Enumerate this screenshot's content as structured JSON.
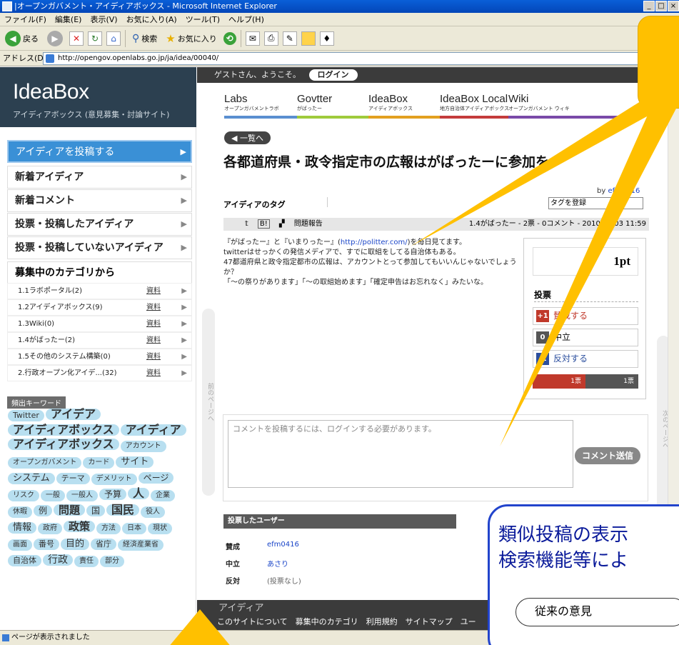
{
  "window": {
    "title": "|オープンガバメント・アイディアボックス - Microsoft Internet Explorer",
    "min": "_",
    "max": "□",
    "close": "×"
  },
  "menu": [
    "ファイル(F)",
    "編集(E)",
    "表示(V)",
    "お気に入り(A)",
    "ツール(T)",
    "ヘルプ(H)"
  ],
  "toolbar": {
    "back": "戻る",
    "search": "検索",
    "favorites": "お気に入り"
  },
  "address": {
    "label": "アドレス(D)",
    "url": "http://opengov.openlabs.go.jp/ja/idea/00040/",
    "go": "▶"
  },
  "sidebar": {
    "logo": "IdeaBox",
    "logo_sub": "アイディアボックス (意見募集・討論サイト)",
    "nav": [
      {
        "label": "アイディアを投稿する"
      },
      {
        "label": "新着アイディア"
      },
      {
        "label": "新着コメント"
      },
      {
        "label": "投票・投稿したアイディア"
      },
      {
        "label": "投票・投稿していないアイディア"
      }
    ],
    "category_header": "募集中のカテゴリから",
    "categories": [
      {
        "label": "1.1ラボポータル(2)",
        "doc": "資料"
      },
      {
        "label": "1.2アイディアボックス(9)",
        "doc": "資料"
      },
      {
        "label": "1.3Wiki(0)",
        "doc": "資料"
      },
      {
        "label": "1.4がばったー(2)",
        "doc": "資料"
      },
      {
        "label": "1.5その他のシステム構築(0)",
        "doc": "資料"
      },
      {
        "label": "2.行政オープン化アイデ...(32)",
        "doc": "資料"
      }
    ],
    "keyword_header": "頻出キーワード",
    "keywords": [
      {
        "t": "Twitter",
        "s": 11
      },
      {
        "t": "アイデア",
        "s": 16
      },
      {
        "t": "アイディアボックス",
        "s": 16
      },
      {
        "t": "アイディア",
        "s": 16
      },
      {
        "t": "アイディアボックス",
        "s": 16
      },
      {
        "t": "アカウント",
        "s": 10
      },
      {
        "t": "オープンガバメント",
        "s": 10
      },
      {
        "t": "カード",
        "s": 10
      },
      {
        "t": "サイト",
        "s": 13
      },
      {
        "t": "システム",
        "s": 13
      },
      {
        "t": "テーマ",
        "s": 11
      },
      {
        "t": "デメリット",
        "s": 10
      },
      {
        "t": "ページ",
        "s": 12
      },
      {
        "t": "リスク",
        "s": 10
      },
      {
        "t": "一般",
        "s": 10
      },
      {
        "t": "一般人",
        "s": 10
      },
      {
        "t": "予算",
        "s": 12
      },
      {
        "t": "人",
        "s": 16
      },
      {
        "t": "企業",
        "s": 10
      },
      {
        "t": "休暇",
        "s": 10
      },
      {
        "t": "例",
        "s": 12
      },
      {
        "t": "問題",
        "s": 15
      },
      {
        "t": "国",
        "s": 12
      },
      {
        "t": "国民",
        "s": 16
      },
      {
        "t": "役人",
        "s": 10
      },
      {
        "t": "情報",
        "s": 13
      },
      {
        "t": "政府",
        "s": 10
      },
      {
        "t": "政策",
        "s": 15
      },
      {
        "t": "方法",
        "s": 10
      },
      {
        "t": "日本",
        "s": 10
      },
      {
        "t": "現状",
        "s": 10
      },
      {
        "t": "画面",
        "s": 10
      },
      {
        "t": "番号",
        "s": 11
      },
      {
        "t": "目的",
        "s": 13
      },
      {
        "t": "省庁",
        "s": 11
      },
      {
        "t": "経済産業省",
        "s": 10
      },
      {
        "t": "自治体",
        "s": 11
      },
      {
        "t": "行政",
        "s": 14
      },
      {
        "t": "責任",
        "s": 10
      },
      {
        "t": "部分",
        "s": 10
      }
    ]
  },
  "header": {
    "greeting": "ゲストさん、ようこそ。",
    "login": "ログイン"
  },
  "sites": [
    {
      "name": "Labs",
      "sub": "オープンガバメントラボ",
      "color": "#5a8fd0"
    },
    {
      "name": "Govtter",
      "sub": "がばったー",
      "color": "#9fcb3c"
    },
    {
      "name": "IdeaBox",
      "sub": "アイディアボックス",
      "color": "#e2a020"
    },
    {
      "name": "IdeaBox Local",
      "sub": "地方自治体アイディアボックス",
      "color": "#c43c3c"
    },
    {
      "name": "Wiki",
      "sub": "オープンガバメント ウィキ",
      "color": "#7a4aa8"
    }
  ],
  "idea": {
    "back": "◀ 一覧へ",
    "title": "各都道府県・政令指定市の広報はがばったーに参加を",
    "tags_label": "アイディアのタグ",
    "by_prefix": "by ",
    "author": "efm0416",
    "tag_select": "タグを登録",
    "report": "問題報告",
    "meta": "1.4がばったー - 2票 - 0コメント - 2010/09/03 11:59",
    "body": [
      {
        "pre": "『がばったー』と『いまりったー』(",
        "link": "http://politter.com/",
        "post": ")を毎日見てます。"
      },
      {
        "pre": "twitterはせっかくの発信メディアで、すでに取組をしてる自治体もある。",
        "link": "",
        "post": ""
      },
      {
        "pre": "47都道府県と政令指定都市の広報は、アカウントとって参加してもいいんじゃないでしょうか？",
        "link": "",
        "post": ""
      },
      {
        "pre": "「～の祭りがあります」「～の取組始めます」「確定申告はお忘れなく」みたいな。",
        "link": "",
        "post": ""
      }
    ]
  },
  "vote": {
    "points": "1pt",
    "header": "投票",
    "agree_badge": "+1",
    "agree": "賛成する",
    "neutral_badge": "0",
    "neutral": "中立",
    "oppose_badge": "-1",
    "oppose": "反対する",
    "tally_agree": "1票",
    "tally_oppose": "1票",
    "colors": {
      "agree": "#c0392b",
      "neutral": "#555555",
      "oppose": "#2c4f9e"
    }
  },
  "nav_tabs": {
    "prev": "前のページへ",
    "next": "次のページへ"
  },
  "comment": {
    "placeholder": "コメントを投稿するには、ログインする必要があります。",
    "send": "コメント送信"
  },
  "voters": {
    "header": "投票したユーザー",
    "rows": [
      {
        "k": "賛成",
        "v": "efm0416"
      },
      {
        "k": "中立",
        "v": "あさり"
      },
      {
        "k": "反対",
        "v": "(投票なし)"
      }
    ]
  },
  "footer": {
    "heading": "アイディア",
    "links": "このサイトについて　募集中のカテゴリ　利用規約　サイトマップ　ユー"
  },
  "status": "ページが表示されました",
  "callout": {
    "line1": "類似投稿の表示",
    "line2": "検索機能等によ",
    "cloud": "従来の意見"
  }
}
